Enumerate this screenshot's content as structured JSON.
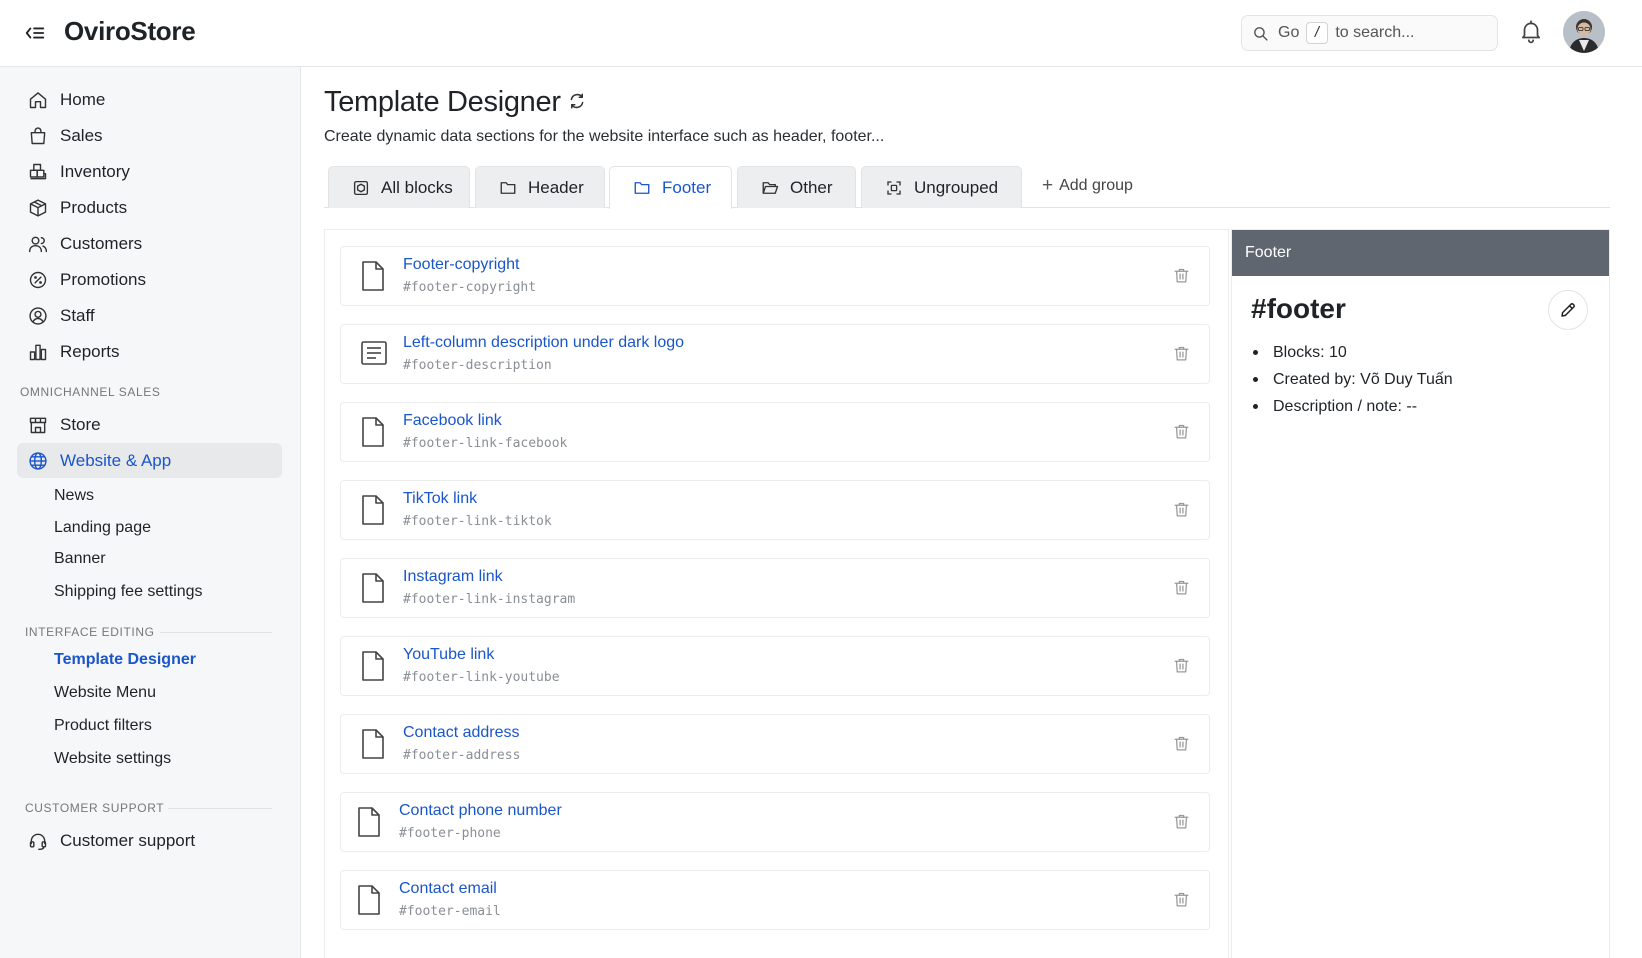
{
  "app": {
    "brand": "OviroStore"
  },
  "search": {
    "prefix": "Go",
    "shortcut": "/",
    "suffix": "to search..."
  },
  "sidebar": {
    "main_items": [
      {
        "label": "Home",
        "icon": "home-icon"
      },
      {
        "label": "Sales",
        "icon": "shopping-bag-icon"
      },
      {
        "label": "Inventory",
        "icon": "warehouse-icon"
      },
      {
        "label": "Products",
        "icon": "package-icon"
      },
      {
        "label": "Customers",
        "icon": "users-icon"
      },
      {
        "label": "Promotions",
        "icon": "discount-icon"
      },
      {
        "label": "Staff",
        "icon": "user-circle-icon"
      },
      {
        "label": "Reports",
        "icon": "bar-chart-icon"
      }
    ],
    "omnichannel_label": "OMNICHANNEL SALES",
    "omnichannel_items": [
      {
        "label": "Store",
        "icon": "store-icon"
      },
      {
        "label": "Website & App",
        "icon": "globe-icon",
        "active": true
      }
    ],
    "website_sub_items": [
      {
        "label": "News"
      },
      {
        "label": "Landing page"
      },
      {
        "label": "Banner"
      },
      {
        "label": "Shipping fee settings"
      }
    ],
    "interface_label": "INTERFACE EDITING",
    "interface_items": [
      {
        "label": "Template Designer",
        "active": true
      },
      {
        "label": "Website Menu"
      },
      {
        "label": "Product filters"
      },
      {
        "label": "Website settings"
      }
    ],
    "support_label": "CUSTOMER SUPPORT",
    "support_items": [
      {
        "label": "Customer support",
        "icon": "headset-icon"
      }
    ]
  },
  "page": {
    "title": "Template Designer",
    "description": "Create dynamic data sections for the website interface such as header, footer..."
  },
  "tabs": [
    {
      "label": "All blocks",
      "icon": "blocks-icon"
    },
    {
      "label": "Header",
      "icon": "folder-icon"
    },
    {
      "label": "Footer",
      "icon": "folder-icon",
      "active": true
    },
    {
      "label": "Other",
      "icon": "folder-open-icon"
    },
    {
      "label": "Ungrouped",
      "icon": "ungrouped-icon"
    }
  ],
  "add_group_label": "Add group",
  "blocks": [
    {
      "name": "Footer-copyright",
      "slug": "#footer-copyright",
      "icon": "file-icon"
    },
    {
      "name": "Left-column description under dark logo",
      "slug": "#footer-description",
      "icon": "file-text-icon"
    },
    {
      "name": "Facebook link",
      "slug": "#footer-link-facebook",
      "icon": "file-icon"
    },
    {
      "name": "TikTok link",
      "slug": "#footer-link-tiktok",
      "icon": "file-icon"
    },
    {
      "name": "Instagram link",
      "slug": "#footer-link-instagram",
      "icon": "file-icon"
    },
    {
      "name": "YouTube link",
      "slug": "#footer-link-youtube",
      "icon": "file-icon"
    },
    {
      "name": "Contact address",
      "slug": "#footer-address",
      "icon": "file-icon"
    },
    {
      "name": "Contact phone number",
      "slug": "#footer-phone",
      "icon": "file-icon"
    },
    {
      "name": "Contact email",
      "slug": "#footer-email",
      "icon": "file-icon"
    }
  ],
  "detail": {
    "header": "Footer",
    "title": "#footer",
    "items": [
      "Blocks: 10",
      "Created by: Võ Duy Tuấn",
      "Description / note: --"
    ]
  },
  "colors": {
    "accent": "#1a56c9",
    "sidebar_bg": "#f6f7f8",
    "detail_header_bg": "#5f6670"
  }
}
